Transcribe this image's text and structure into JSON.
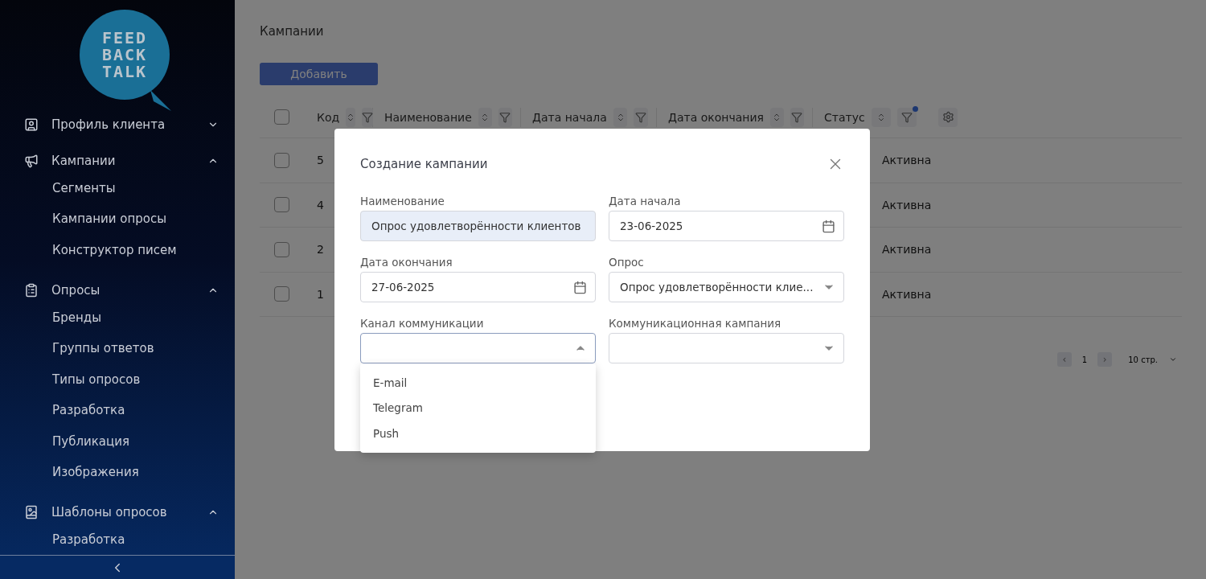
{
  "logo": {
    "lines": [
      "FEED",
      "BACK",
      "TALK"
    ]
  },
  "sidebar": {
    "items": [
      {
        "label": "Профиль клиента",
        "expanded": false
      },
      {
        "label": "Кампании",
        "expanded": true,
        "children": [
          {
            "label": "Сегменты"
          },
          {
            "label": "Кампании опросы"
          },
          {
            "label": "Конструктор писем"
          }
        ]
      },
      {
        "label": "Опросы",
        "expanded": true,
        "children": [
          {
            "label": "Бренды"
          },
          {
            "label": "Группы ответов"
          },
          {
            "label": "Типы опросов"
          },
          {
            "label": "Разработка"
          },
          {
            "label": "Публикация"
          },
          {
            "label": "Изображения"
          }
        ]
      },
      {
        "label": "Шаблоны опросов",
        "expanded": true,
        "children": [
          {
            "label": "Разработка"
          }
        ]
      }
    ]
  },
  "page": {
    "title": "Кампании",
    "add_button": "Добавить"
  },
  "table": {
    "all_checked": false,
    "columns": [
      {
        "label": "Код",
        "filtered": false
      },
      {
        "label": "Наименование",
        "filtered": false
      },
      {
        "label": "Дата начала",
        "filtered": false
      },
      {
        "label": "Дата окончания",
        "filtered": false
      },
      {
        "label": "Статус",
        "filtered": true
      }
    ],
    "rows": [
      {
        "code": "5",
        "status": "Активна",
        "checked": false
      },
      {
        "code": "4",
        "status": "Активна",
        "checked": false
      },
      {
        "code": "2",
        "status": "Активна",
        "checked": false
      },
      {
        "code": "1",
        "status": "Активна",
        "checked": false
      }
    ]
  },
  "pagination": {
    "prev": "‹",
    "page": "1",
    "next": "›",
    "page_size": "10 стр."
  },
  "modal": {
    "title": "Создание кампании",
    "fields": [
      {
        "label": "Наименование",
        "kind": "text",
        "value": "Опрос удовлетворённости клиентов"
      },
      {
        "label": "Дата начала",
        "kind": "date",
        "value": "23-06-2025"
      },
      {
        "label": "Дата окончания",
        "kind": "date",
        "value": "27-06-2025"
      },
      {
        "label": "Опрос",
        "kind": "select",
        "value": "Опрос удовлетворённости клие...",
        "expanded": false
      },
      {
        "label": "Канал коммуникации",
        "kind": "select",
        "expanded": true,
        "options": [
          "E-mail",
          "Telegram",
          "Push"
        ]
      },
      {
        "label": "Коммуникационная кампания",
        "kind": "select",
        "expanded": false
      }
    ]
  }
}
